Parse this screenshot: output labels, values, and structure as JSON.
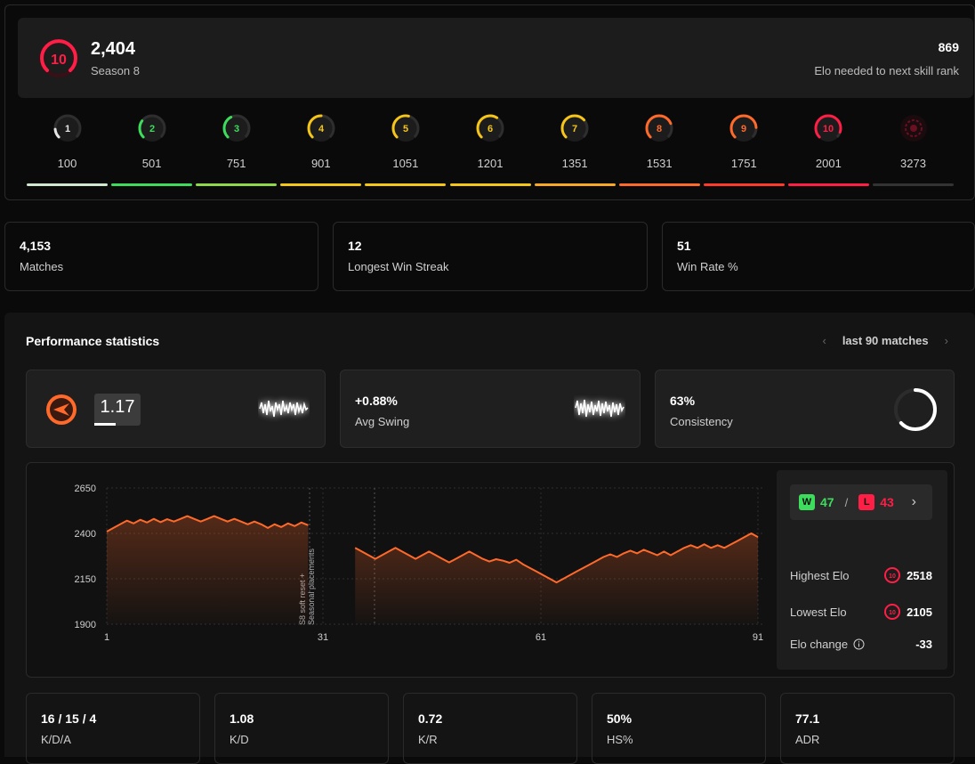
{
  "header": {
    "level": "10",
    "elo": "2,404",
    "season": "Season 8",
    "elo_needed_value": "869",
    "elo_needed_label": "Elo needed to next skill rank"
  },
  "levels": [
    {
      "n": "1",
      "thr": "100",
      "color": "#e6e6e6",
      "fill": 0.15
    },
    {
      "n": "2",
      "thr": "501",
      "color": "#3ddc5c",
      "fill": 0.3
    },
    {
      "n": "3",
      "thr": "751",
      "color": "#3ddc5c",
      "fill": 0.4
    },
    {
      "n": "4",
      "thr": "901",
      "color": "#f5c518",
      "fill": 0.5
    },
    {
      "n": "5",
      "thr": "1051",
      "color": "#f5c518",
      "fill": 0.55
    },
    {
      "n": "6",
      "thr": "1201",
      "color": "#f5c518",
      "fill": 0.62
    },
    {
      "n": "7",
      "thr": "1351",
      "color": "#f5c518",
      "fill": 0.68
    },
    {
      "n": "8",
      "thr": "1531",
      "color": "#ff6a2b",
      "fill": 0.75
    },
    {
      "n": "9",
      "thr": "1751",
      "color": "#ff6a2b",
      "fill": 0.82
    },
    {
      "n": "10",
      "thr": "2001",
      "color": "#ff1e46",
      "fill": 0.9
    },
    {
      "n": "",
      "thr": "3273",
      "color": "#6a1020",
      "fill": 1.0
    }
  ],
  "progress_bar_colors": [
    "#cfe8cf",
    "#3ddc5c",
    "#8fd84a",
    "#f5c518",
    "#f5c518",
    "#f5c518",
    "#f9a825",
    "#ff6a2b",
    "#ff3a2b",
    "#ff1e46",
    "#333333"
  ],
  "stats": [
    {
      "value": "4,153",
      "label": "Matches"
    },
    {
      "value": "12",
      "label": "Longest Win Streak"
    },
    {
      "value": "51",
      "label": "Win Rate %"
    }
  ],
  "performance": {
    "title": "Performance statistics",
    "range_label": "last 90 matches",
    "rating_value": "1.17",
    "avg_swing_value": "+0.88%",
    "avg_swing_label": "Avg Swing",
    "consistency_value": "63%",
    "consistency_label": "Consistency",
    "consistency_fill": 0.63
  },
  "chart_data": {
    "type": "area",
    "x_ticks": [
      "1",
      "31",
      "61",
      "91"
    ],
    "y_ticks": [
      "2650",
      "2400",
      "2150",
      "1900"
    ],
    "ylim": [
      1900,
      2650
    ],
    "xlim": [
      1,
      91
    ],
    "annotation": "S8 soft reset + Seasonal placements",
    "series": [
      {
        "values": [
          [
            1,
            2410
          ],
          [
            2,
            2430
          ],
          [
            3,
            2450
          ],
          [
            4,
            2470
          ],
          [
            5,
            2455
          ],
          [
            6,
            2475
          ],
          [
            7,
            2460
          ],
          [
            8,
            2480
          ],
          [
            9,
            2462
          ],
          [
            10,
            2478
          ],
          [
            11,
            2465
          ],
          [
            12,
            2480
          ],
          [
            13,
            2495
          ],
          [
            14,
            2480
          ],
          [
            15,
            2465
          ],
          [
            16,
            2480
          ],
          [
            17,
            2495
          ],
          [
            18,
            2480
          ],
          [
            19,
            2465
          ],
          [
            20,
            2480
          ],
          [
            21,
            2465
          ],
          [
            22,
            2450
          ],
          [
            23,
            2465
          ],
          [
            24,
            2450
          ],
          [
            25,
            2430
          ],
          [
            26,
            2450
          ],
          [
            27,
            2435
          ],
          [
            28,
            2455
          ],
          [
            29,
            2440
          ],
          [
            30,
            2460
          ],
          [
            31,
            2445
          ]
        ]
      },
      {
        "values": [
          [
            38,
            2320
          ],
          [
            39,
            2300
          ],
          [
            40,
            2280
          ],
          [
            41,
            2260
          ],
          [
            42,
            2280
          ],
          [
            43,
            2300
          ],
          [
            44,
            2320
          ],
          [
            45,
            2300
          ],
          [
            46,
            2280
          ],
          [
            47,
            2260
          ],
          [
            48,
            2280
          ],
          [
            49,
            2300
          ],
          [
            50,
            2280
          ],
          [
            51,
            2260
          ],
          [
            52,
            2240
          ],
          [
            53,
            2260
          ],
          [
            54,
            2280
          ],
          [
            55,
            2300
          ],
          [
            56,
            2280
          ],
          [
            57,
            2260
          ],
          [
            58,
            2245
          ],
          [
            59,
            2258
          ],
          [
            60,
            2250
          ],
          [
            61,
            2238
          ],
          [
            62,
            2255
          ],
          [
            63,
            2230
          ],
          [
            64,
            2210
          ],
          [
            65,
            2190
          ],
          [
            66,
            2170
          ],
          [
            67,
            2150
          ],
          [
            68,
            2130
          ],
          [
            69,
            2150
          ],
          [
            70,
            2170
          ],
          [
            71,
            2190
          ],
          [
            72,
            2210
          ],
          [
            73,
            2230
          ],
          [
            74,
            2250
          ],
          [
            75,
            2270
          ],
          [
            76,
            2285
          ],
          [
            77,
            2270
          ],
          [
            78,
            2290
          ],
          [
            79,
            2305
          ],
          [
            80,
            2290
          ],
          [
            81,
            2310
          ],
          [
            82,
            2295
          ],
          [
            83,
            2280
          ],
          [
            84,
            2300
          ],
          [
            85,
            2280
          ],
          [
            86,
            2300
          ],
          [
            87,
            2320
          ],
          [
            88,
            2335
          ],
          [
            89,
            2320
          ],
          [
            90,
            2340
          ],
          [
            91,
            2320
          ],
          [
            92,
            2335
          ],
          [
            93,
            2320
          ],
          [
            94,
            2340
          ],
          [
            95,
            2360
          ],
          [
            96,
            2380
          ],
          [
            97,
            2400
          ],
          [
            98,
            2380
          ]
        ]
      }
    ]
  },
  "side": {
    "wins_tag": "W",
    "wins": "47",
    "sep": "/",
    "losses_tag": "L",
    "losses": "43",
    "highest_label": "Highest Elo",
    "highest_value": "2518",
    "lowest_label": "Lowest Elo",
    "lowest_value": "2105",
    "change_label": "Elo change",
    "change_value": "-33",
    "badge_level": "10"
  },
  "bottom": [
    {
      "value": "16 / 15 / 4",
      "label": "K/D/A"
    },
    {
      "value": "1.08",
      "label": "K/D"
    },
    {
      "value": "0.72",
      "label": "K/R"
    },
    {
      "value": "50%",
      "label": "HS%"
    },
    {
      "value": "77.1",
      "label": "ADR"
    }
  ],
  "colors": {
    "accent": "#ff6a2b",
    "win": "#3ddc5c",
    "loss": "#ff1e46"
  }
}
